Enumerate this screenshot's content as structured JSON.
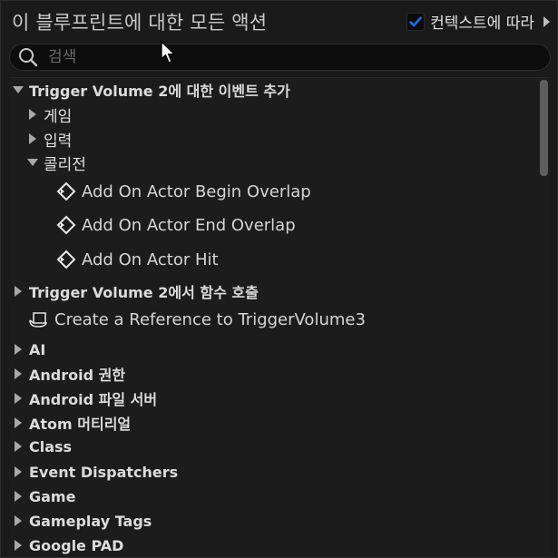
{
  "header": {
    "title": "이 블루프린트에 대한 모든 액션",
    "context_label": "컨텍스트에 따라",
    "context_checked": true
  },
  "search": {
    "placeholder": "검색",
    "value": ""
  },
  "tree": {
    "root_events_label": "Trigger Volume 2에 대한 이벤트 추가",
    "game_label": "게임",
    "input_label": "입력",
    "collision_label": "콜리전",
    "collision_actions": [
      "Add On Actor Begin Overlap",
      "Add On Actor End Overlap",
      "Add On Actor Hit"
    ],
    "call_function_label": "Trigger Volume 2에서 함수 호출",
    "create_reference_label": "Create a Reference to TriggerVolume3",
    "categories": [
      "AI",
      "Android 권한",
      "Android 파일 서버",
      "Atom 머티리얼",
      "Class",
      "Event Dispatchers",
      "Game",
      "Gameplay Tags",
      "Google PAD"
    ]
  },
  "colors": {
    "accent": "#1e6ee8",
    "background": "#1a1a1a",
    "text": "#d8d8d8"
  },
  "icons": {
    "context_checkbox": "checkmark-icon",
    "search": "search-icon",
    "event_action": "event-diamond-icon",
    "reference": "actor-reference-icon"
  }
}
